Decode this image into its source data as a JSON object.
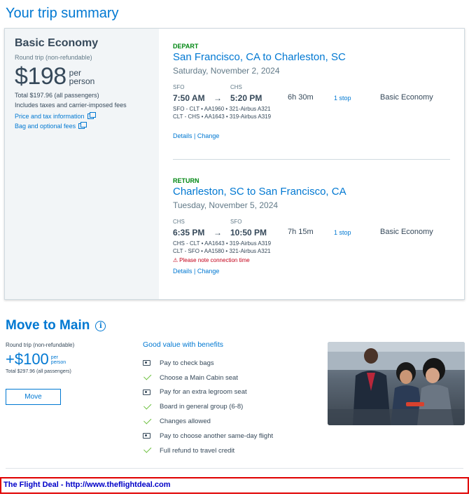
{
  "page": {
    "title": "Your trip summary"
  },
  "fare": {
    "name": "Basic Economy",
    "trip_type": "Round trip (non-refundable)",
    "price": "$198",
    "per_line1": "per",
    "per_line2": "person",
    "total": "Total $197.96 (all passengers)",
    "includes": "Includes taxes and carrier-imposed fees",
    "link_price_tax": "Price and tax information",
    "link_bag_fees": "Bag and optional fees"
  },
  "legs": [
    {
      "label": "DEPART",
      "route": "San Francisco, CA to Charleston, SC",
      "date": "Saturday, November 2, 2024",
      "from_code": "SFO",
      "to_code": "CHS",
      "depart_time": "7:50 AM",
      "arrow": "→",
      "arrive_time": "5:20 PM",
      "duration": "6h 30m",
      "stops": "1 stop",
      "cabin": "Basic Economy",
      "segments": [
        "SFO - CLT • AA1960 • 321-Airbus A321",
        "CLT - CHS • AA1643 • 319-Airbus A319"
      ],
      "warning": "",
      "link_details": "Details",
      "link_sep": "|",
      "link_change": "Change"
    },
    {
      "label": "RETURN",
      "route": "Charleston, SC to San Francisco, CA",
      "date": "Tuesday, November 5, 2024",
      "from_code": "CHS",
      "to_code": "SFO",
      "depart_time": "6:35 PM",
      "arrow": "→",
      "arrive_time": "10:50 PM",
      "duration": "7h 15m",
      "stops": "1 stop",
      "cabin": "Basic Economy",
      "segments": [
        "CHS - CLT • AA1643 • 319-Airbus A319",
        "CLT - SFO • AA1580 • 321-Airbus A321"
      ],
      "warning": "Please note connection time",
      "link_details": "Details",
      "link_sep": "|",
      "link_change": "Change"
    }
  ],
  "upsell": {
    "title": "Move to Main",
    "info_glyph": "i",
    "trip_type": "Round trip (non-refundable)",
    "price": "+$100",
    "per_line1": "per",
    "per_line2": "person",
    "total": "Total $297.96 (all passengers)",
    "button": "Move",
    "benefits_heading": "Good value with benefits",
    "benefits": [
      {
        "icon": "pay-icon",
        "text": "Pay to check bags"
      },
      {
        "icon": "check-icon",
        "text": "Choose a Main Cabin seat"
      },
      {
        "icon": "pay-icon",
        "text": "Pay for an extra legroom seat"
      },
      {
        "icon": "check-icon",
        "text": "Board in general group (6-8)"
      },
      {
        "icon": "check-icon",
        "text": "Changes allowed"
      },
      {
        "icon": "pay-icon",
        "text": "Pay to choose another same-day flight"
      },
      {
        "icon": "check-icon",
        "text": "Full refund to travel credit"
      }
    ]
  },
  "footer": {
    "text": "The Flight Deal - http://www.theflightdeal.com"
  },
  "colors": {
    "brand_blue": "#0078d2",
    "depart_green": "#008712",
    "warning_red": "#c30019",
    "footer_red": "#e00000"
  }
}
